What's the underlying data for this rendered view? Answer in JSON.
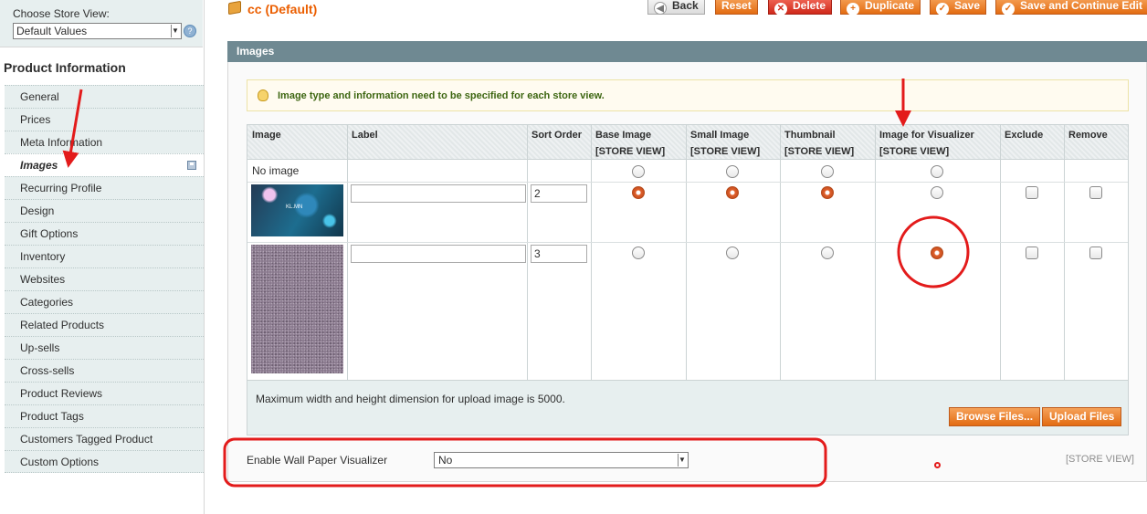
{
  "store_switcher": {
    "label": "Choose Store View:",
    "selected": "Default Values",
    "help_icon": "help-icon"
  },
  "sidebar": {
    "title": "Product Information",
    "items": [
      {
        "label": "General"
      },
      {
        "label": "Prices"
      },
      {
        "label": "Meta Information"
      },
      {
        "label": "Images",
        "active": true,
        "icon": "disk-icon"
      },
      {
        "label": "Recurring Profile"
      },
      {
        "label": "Design"
      },
      {
        "label": "Gift Options"
      },
      {
        "label": "Inventory"
      },
      {
        "label": "Websites"
      },
      {
        "label": "Categories"
      },
      {
        "label": "Related Products"
      },
      {
        "label": "Up-sells"
      },
      {
        "label": "Cross-sells"
      },
      {
        "label": "Product Reviews"
      },
      {
        "label": "Product Tags"
      },
      {
        "label": "Customers Tagged Product"
      },
      {
        "label": "Custom Options"
      }
    ]
  },
  "header": {
    "title": "cc (Default)",
    "buttons": {
      "back": "Back",
      "reset": "Reset",
      "delete": "Delete",
      "duplicate": "Duplicate",
      "save": "Save",
      "save_continue": "Save and Continue Edit"
    }
  },
  "images_section": {
    "title": "Images",
    "notice": "Image type and information need to be specified for each store view.",
    "columns": {
      "image": "Image",
      "label": "Label",
      "sort_order": "Sort Order",
      "base_image": "Base Image",
      "small_image": "Small Image",
      "thumbnail": "Thumbnail",
      "visualizer": "Image for Visualizer",
      "exclude": "Exclude",
      "remove": "Remove",
      "store_view": "[STORE VIEW]"
    },
    "no_image_label": "No image",
    "rows": [
      {
        "label": "",
        "sort_order": "2",
        "base": true,
        "small": true,
        "thumbnail": true,
        "visualizer": false,
        "exclude": false,
        "remove": false,
        "thumb_caption": "KL.MN"
      },
      {
        "label": "",
        "sort_order": "3",
        "base": false,
        "small": false,
        "thumbnail": false,
        "visualizer": true,
        "exclude": false,
        "remove": false
      }
    ],
    "upload_note": "Maximum width and height dimension for upload image is 5000.",
    "browse_button": "Browse Files...",
    "upload_button": "Upload Files"
  },
  "wallpaper": {
    "label": "Enable Wall Paper Visualizer",
    "value": "No",
    "scope": "[STORE VIEW]"
  },
  "colors": {
    "accent_orange": "#eb5e00",
    "section_bar": "#6f8992",
    "annotation_red": "#e31b1b"
  }
}
